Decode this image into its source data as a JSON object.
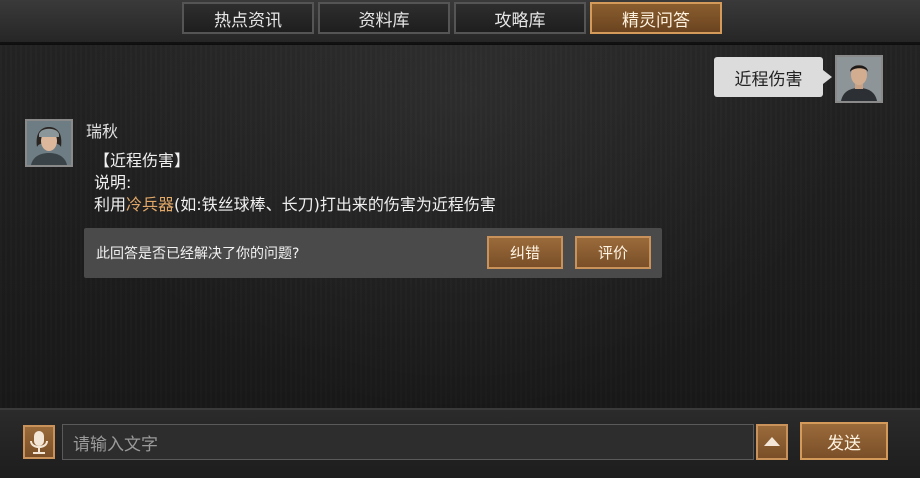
{
  "tabs": [
    {
      "label": "热点资讯",
      "active": false
    },
    {
      "label": "资料库",
      "active": false
    },
    {
      "label": "攻略库",
      "active": false
    },
    {
      "label": "精灵问答",
      "active": true
    }
  ],
  "user_message": {
    "text": "近程伤害",
    "avatar_icon": "user-avatar-icon"
  },
  "bot_message": {
    "name": "瑞秋",
    "avatar_icon": "bot-avatar-icon",
    "title_line": "【近程伤害】",
    "desc_label": "说明:",
    "desc_prefix": "利用",
    "desc_highlight": "冷兵器",
    "desc_suffix": "(如:铁丝球棒、长刀)打出来的伤害为近程伤害"
  },
  "feedback": {
    "question": "此回答是否已经解决了你的问题?",
    "correct_label": "纠错",
    "rate_label": "评价"
  },
  "input_bar": {
    "mic_icon": "microphone-icon",
    "placeholder": "请输入文字",
    "expand_icon": "chevron-up-icon",
    "send_label": "发送"
  },
  "colors": {
    "accent_orange": "#8a5d2e",
    "highlight_text": "#e2a868",
    "bubble_gray": "#dcdcdc"
  }
}
